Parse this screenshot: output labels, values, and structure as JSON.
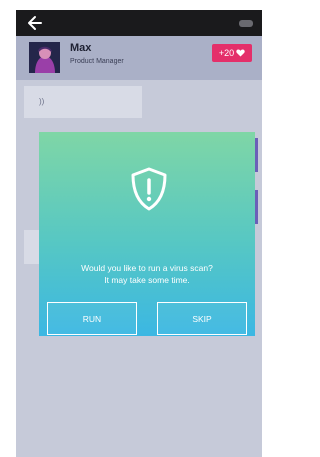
{
  "header": {
    "name": "Max",
    "role": "Product Manager",
    "points": "+20"
  },
  "chat": {
    "incoming_text": "))"
  },
  "dialog": {
    "line1": "Would you like to run a virus scan?",
    "line2": "It may take some time.",
    "run_label": "RUN",
    "skip_label": "SKIP"
  },
  "colors": {
    "accent": "#e42f6a",
    "dialog_top": "#7fd6a6",
    "dialog_bottom": "#3bb7e3"
  },
  "icons": [
    "back-arrow-icon",
    "battery-icon",
    "heart-icon",
    "shield-exclamation-icon"
  ]
}
